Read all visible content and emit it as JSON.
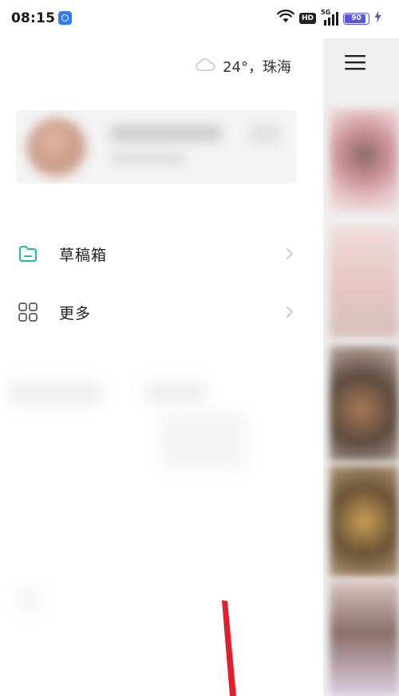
{
  "status_bar": {
    "time": "08:15",
    "hd": "HD",
    "network": "5G",
    "battery": "90",
    "battery_level": 0.9
  },
  "drawer": {
    "weather": {
      "icon": "cloud-icon",
      "text": "24°，珠海"
    },
    "menu": [
      {
        "label": "草稿箱",
        "icon": "folder-icon",
        "accent": "#1fbf8f"
      },
      {
        "label": "更多",
        "icon": "grid-icon"
      }
    ]
  },
  "right_panel": {
    "menu_icon": "hamburger-menu-icon"
  },
  "colors": {
    "battery": "#5b57d6",
    "accent_green": "#1fbf8f",
    "annotation_red": "#e31d2e"
  }
}
